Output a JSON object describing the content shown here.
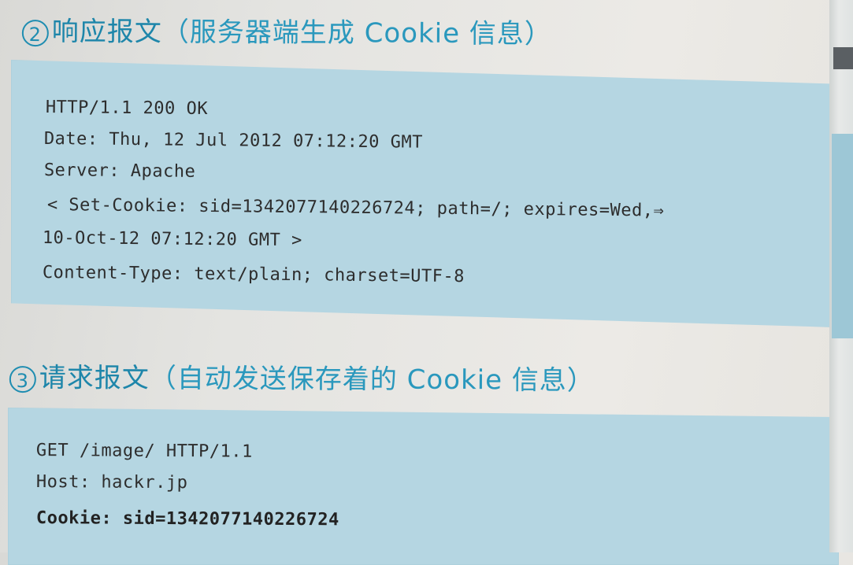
{
  "response_section": {
    "number": "2",
    "title": "响应报文",
    "subtitle": "（服务器端生成 Cookie 信息）",
    "lines": [
      "HTTP/1.1 200 OK",
      "Date: Thu, 12 Jul 2012 07:12:20 GMT",
      "Server: Apache",
      "< Set-Cookie: sid=1342077140226724; path=/; expires=Wed,⇒",
      "10-Oct-12 07:12:20 GMT >",
      "Content-Type: text/plain; charset=UTF-8"
    ]
  },
  "request_section": {
    "number": "3",
    "title": "请求报文",
    "subtitle": "（自动发送保存着的 Cookie 信息）",
    "lines": [
      "GET /image/ HTTP/1.1",
      "Host: hackr.jp",
      "Cookie: sid=1342077140226724"
    ]
  },
  "colors": {
    "heading": "#1f8db1",
    "code_background": "#b5d6e2",
    "code_text": "#2d2d2d"
  }
}
